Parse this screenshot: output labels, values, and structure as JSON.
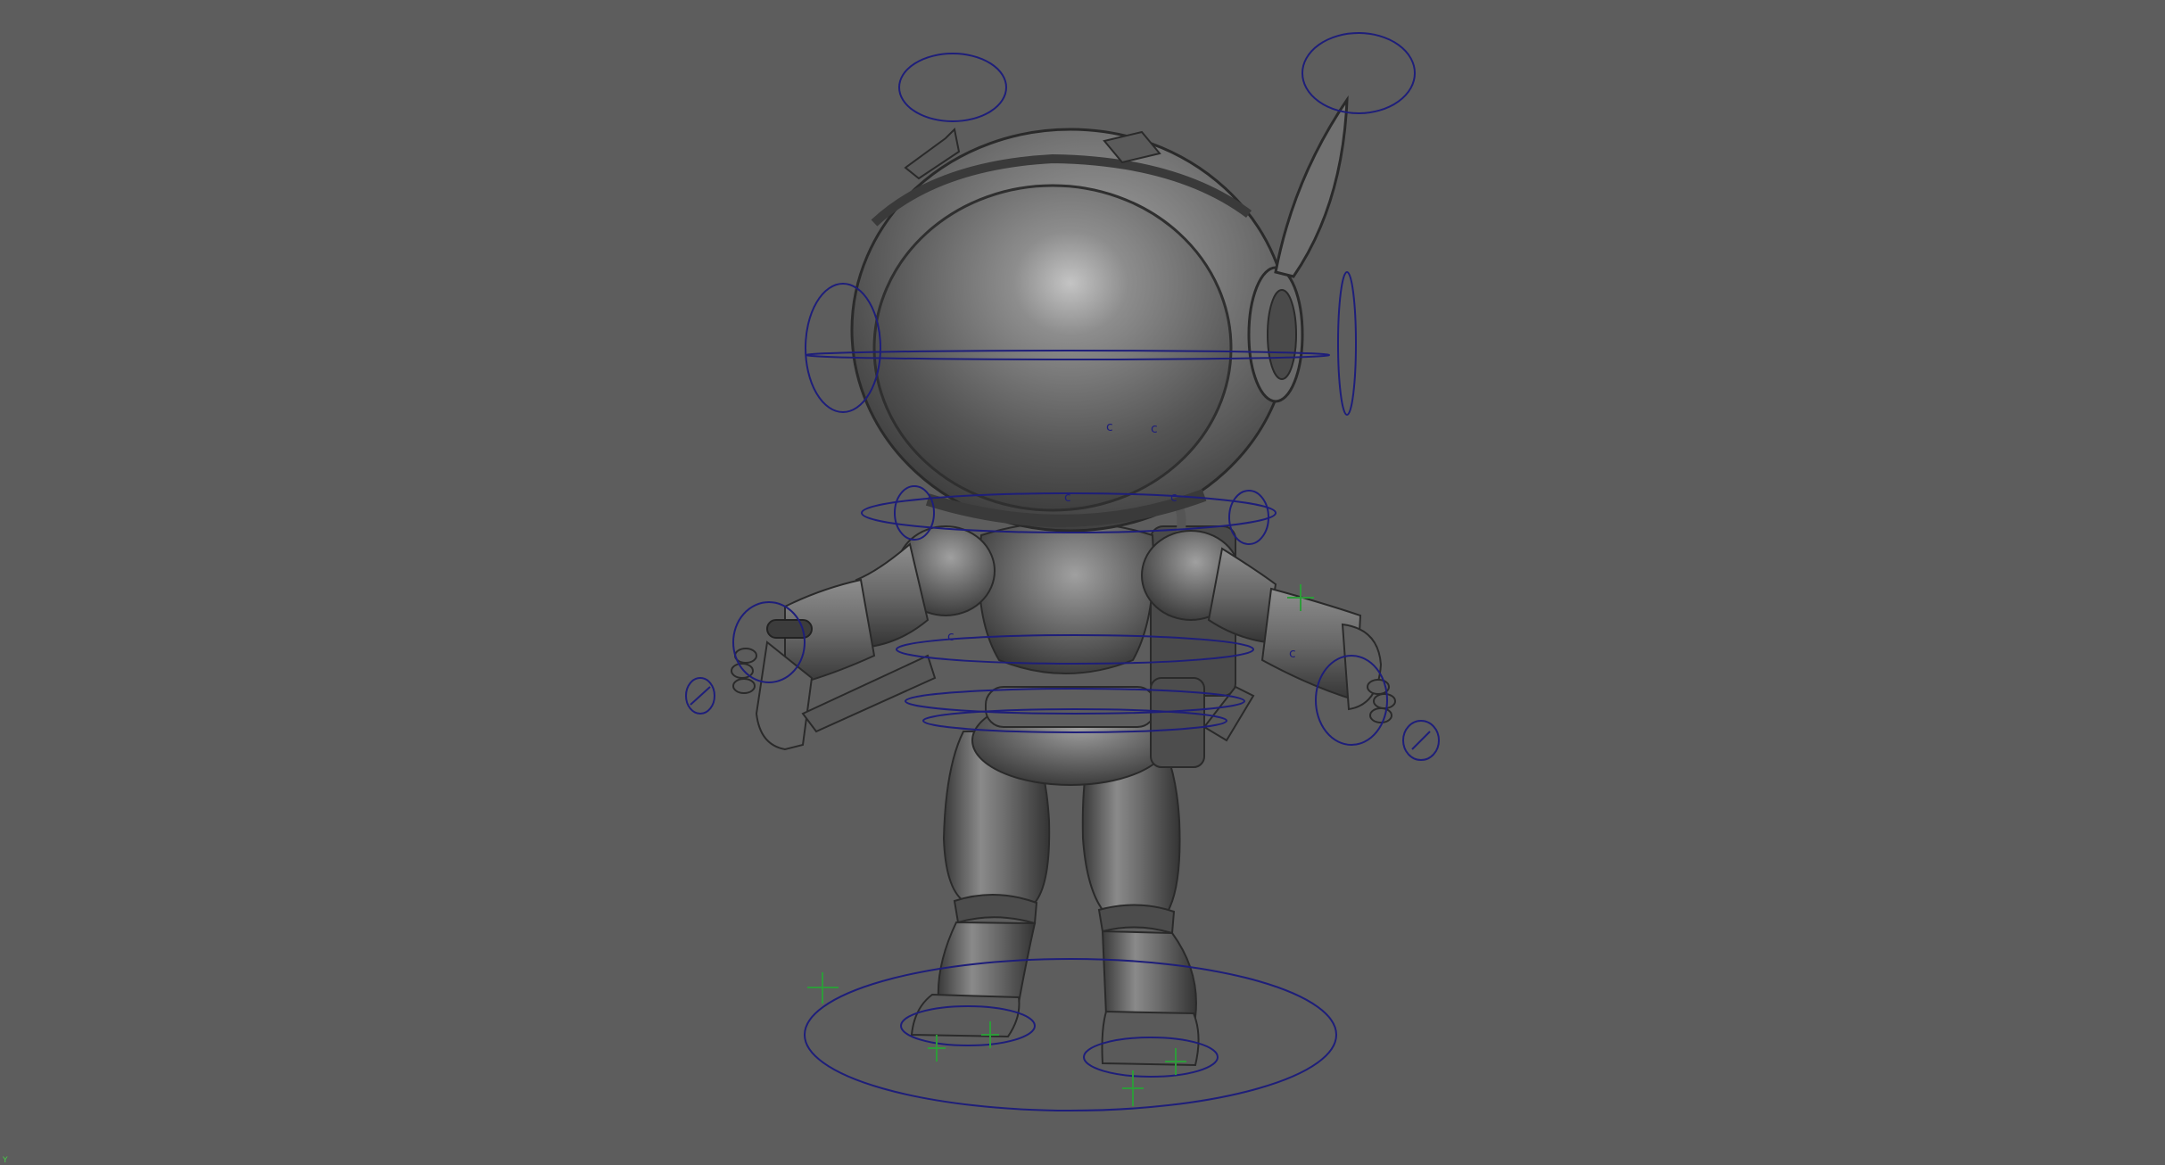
{
  "viewport": {
    "background": "#5d5d5d",
    "mode": "smooth-shaded"
  },
  "model": {
    "body_color": "#6f6f6f",
    "highlight_color": "#a6a6a6",
    "shadow_color": "#3a3a3a"
  },
  "rig": {
    "control_color": "#1e1e7a",
    "locator_color": "#2e9b3a",
    "cluster_marker": "c"
  },
  "axis": {
    "y_label": "Y",
    "y_color": "#45d045"
  }
}
